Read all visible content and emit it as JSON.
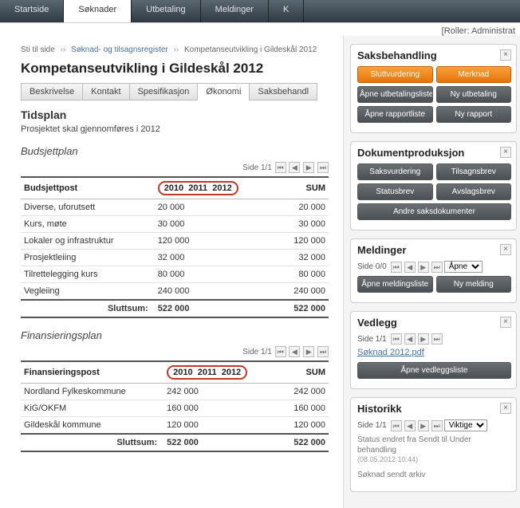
{
  "topnav": {
    "tabs": [
      "Startside",
      "Søknader",
      "Utbetaling",
      "Meldinger",
      "K"
    ],
    "active_index": 1
  },
  "topbar": {
    "roles_label": "[Roller:",
    "roles_value": "Administrat"
  },
  "breadcrumb": {
    "prefix": "Sti til side",
    "items": [
      "Søknad- og tilsagnsregister",
      "Kompetanseutvikling i Gildeskål 2012"
    ]
  },
  "page_title": "Kompetanseutvikling i Gildeskål 2012",
  "subtabs": {
    "items": [
      "Beskrivelse",
      "Kontakt",
      "Spesifikasjon",
      "Økonomi",
      "Saksbehandl"
    ],
    "active_index": 3
  },
  "tidsplan": {
    "heading": "Tidsplan",
    "text": "Prosjektet skal gjennomføres i 2012"
  },
  "budsjett": {
    "heading": "Budsjettplan",
    "pager": "Side 1/1",
    "col_label": "Budsjettpost",
    "years": [
      "2010",
      "2011",
      "2012"
    ],
    "sum_label": "SUM",
    "rows": [
      {
        "label": "Diverse, uforutsett",
        "y2010": "20 000",
        "y2011": "",
        "y2012": "",
        "sum": "20 000"
      },
      {
        "label": "Kurs, møte",
        "y2010": "30 000",
        "y2011": "",
        "y2012": "",
        "sum": "30 000"
      },
      {
        "label": "Lokaler og infrastruktur",
        "y2010": "120 000",
        "y2011": "",
        "y2012": "",
        "sum": "120 000"
      },
      {
        "label": "Prosjektleiing",
        "y2010": "32 000",
        "y2011": "",
        "y2012": "",
        "sum": "32 000"
      },
      {
        "label": "Tilrettelegging kurs",
        "y2010": "80 000",
        "y2011": "",
        "y2012": "",
        "sum": "80 000"
      },
      {
        "label": "Vegleiing",
        "y2010": "240 000",
        "y2011": "",
        "y2012": "",
        "sum": "240 000"
      }
    ],
    "total_label": "Sluttsum:",
    "total_2010": "522 000",
    "total_sum": "522 000"
  },
  "finans": {
    "heading": "Finansieringsplan",
    "pager": "Side 1/1",
    "col_label": "Finansieringspost",
    "years": [
      "2010",
      "2011",
      "2012"
    ],
    "sum_label": "SUM",
    "rows": [
      {
        "label": "Nordland Fylkeskommune",
        "y2010": "242 000",
        "y2011": "",
        "y2012": "",
        "sum": "242 000"
      },
      {
        "label": "KiG/OKFM",
        "y2010": "160 000",
        "y2011": "",
        "y2012": "",
        "sum": "160 000"
      },
      {
        "label": "Gildeskål kommune",
        "y2010": "120 000",
        "y2011": "",
        "y2012": "",
        "sum": "120 000"
      }
    ],
    "total_label": "Sluttsum:",
    "total_2010": "522 000",
    "total_sum": "522 000"
  },
  "right": {
    "saks": {
      "title": "Saksbehandling",
      "btns": {
        "sluttvurdering": "Sluttvurdering",
        "merknad": "Merknad",
        "apne_utb": "Åpne utbetalingsliste",
        "ny_utb": "Ny utbetaling",
        "apne_rapp": "Åpne rapportliste",
        "ny_rapp": "Ny rapport"
      }
    },
    "dok": {
      "title": "Dokumentproduksjon",
      "btns": {
        "saksvurdering": "Saksvurdering",
        "tilsagnsbrev": "Tilsagnsbrev",
        "statusbrev": "Statusbrev",
        "avslagsbrev": "Avslagsbrev",
        "andre": "Andre saksdokumenter"
      }
    },
    "meldinger": {
      "title": "Meldinger",
      "pager": "Side 0/0",
      "select": "Åpne",
      "apne": "Åpne meldingsliste",
      "ny": "Ny melding"
    },
    "vedlegg": {
      "title": "Vedlegg",
      "pager": "Side 1/1",
      "file": "Søknad 2012.pdf",
      "apne": "Åpne vedleggsliste"
    },
    "historikk": {
      "title": "Historikk",
      "pager": "Side 1/1",
      "select": "Viktige",
      "items": [
        {
          "text": "Status endret fra Sendt til Under behandling",
          "ts": "(08.05.2012 10:44)"
        },
        {
          "text": "Søknad sendt arkiv",
          "ts": ""
        }
      ]
    }
  }
}
